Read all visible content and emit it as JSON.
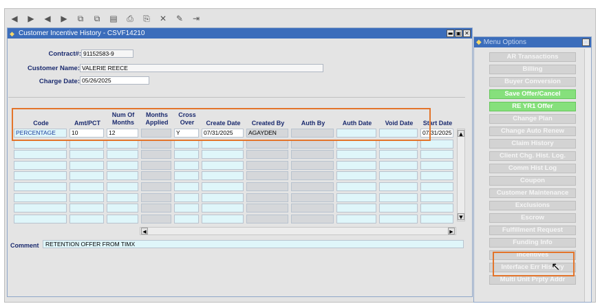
{
  "toolbar": {
    "icons": [
      "first-record-icon",
      "previous-record-icon",
      "previous-set-icon",
      "next-set-icon",
      "insert-record-icon",
      "duplicate-record-icon",
      "list-icon",
      "print-icon",
      "save-icon",
      "delete-icon",
      "edit-icon",
      "exit-icon"
    ],
    "glyphs": [
      "◀",
      "▶",
      "◀",
      "▶",
      "⧉",
      "⧉",
      "▤",
      "⎙",
      "⎘",
      "✕",
      "✎",
      "⇥"
    ]
  },
  "window": {
    "title": "Customer Incentive History - CSVF14210",
    "controls": [
      "▬",
      "▣",
      "✕"
    ]
  },
  "header": {
    "contract_label": "Contract#:",
    "contract_value": "91152583-9",
    "customer_name_label": "Customer Name:",
    "customer_name_value": "VALERIE REECE",
    "charge_date_label": "Charge Date:",
    "charge_date_value": "05/26/2025"
  },
  "grid": {
    "columns": [
      "Code",
      "Amt/PCT",
      "Num Of\nMonths",
      "Months\nApplied",
      "Cross\nOver",
      "Create Date",
      "Created By",
      "Auth By",
      "Auth Date",
      "Void Date",
      "Start Date"
    ],
    "rows": [
      [
        "PERCENTAGE",
        "10",
        "12",
        "",
        "Y",
        "07/31/2025",
        "AGAYDEN",
        "",
        "",
        "",
        "07/31/2025"
      ]
    ],
    "empty_rows": 8
  },
  "comment": {
    "label": "Comment",
    "value": "RETENTION OFFER FROM TIMX"
  },
  "menu": {
    "title": "Menu Options",
    "items": [
      {
        "label": "AR Transactions",
        "style": "gray"
      },
      {
        "label": "Billing",
        "style": "gray"
      },
      {
        "label": "Buyer Conversion",
        "style": "gray"
      },
      {
        "label": "Save Offer/Cancel",
        "style": "green"
      },
      {
        "label": "RE YR1 Offer",
        "style": "green"
      },
      {
        "label": "Change Plan",
        "style": "gray"
      },
      {
        "label": "Change Auto Renew",
        "style": "gray"
      },
      {
        "label": "Claim History",
        "style": "gray"
      },
      {
        "label": "Client Chg. Hist. Log.",
        "style": "gray"
      },
      {
        "label": "Comm Hist Log",
        "style": "gray"
      },
      {
        "label": "Coupon",
        "style": "gray"
      },
      {
        "label": "Customer Maintenance",
        "style": "gray"
      },
      {
        "label": "Exclusions",
        "style": "gray"
      },
      {
        "label": "Escrow",
        "style": "gray"
      },
      {
        "label": "Fulfillment Request",
        "style": "gray"
      },
      {
        "label": "Funding Info",
        "style": "gray"
      },
      {
        "label": "Incentives",
        "style": "gray"
      },
      {
        "label": "Interface Err History",
        "style": "gray"
      },
      {
        "label": "Multi Unit Prpty Addr",
        "style": "gray"
      }
    ]
  },
  "colors": {
    "title_bar": "#3b6dbb",
    "highlight": "#e3742a",
    "green_button": "#86e07c",
    "label_text": "#1a2a6e"
  }
}
